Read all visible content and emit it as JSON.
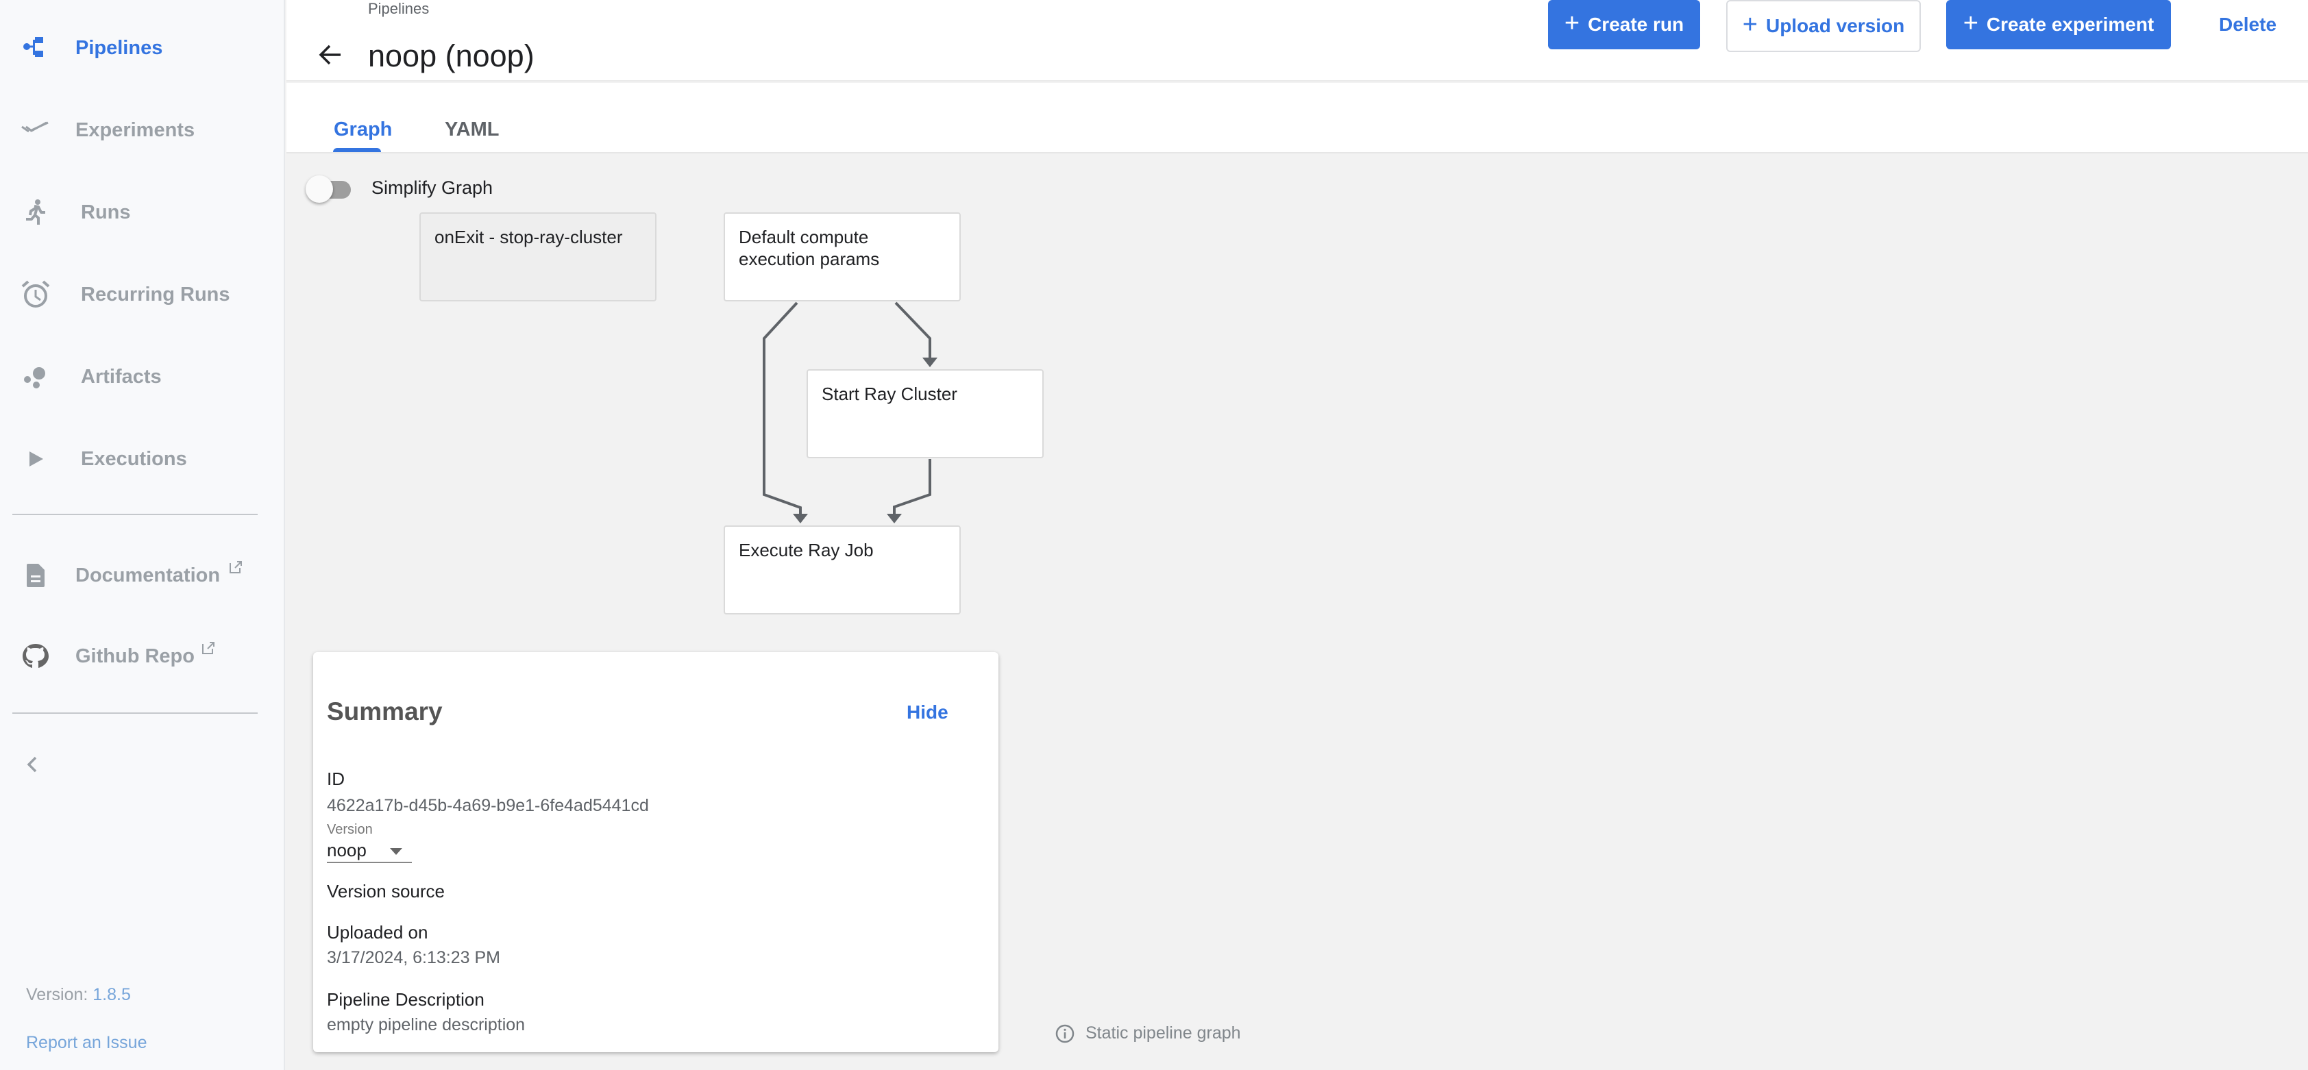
{
  "sidebar": {
    "items": [
      {
        "label": "Pipelines",
        "icon": "pipelines-icon",
        "active": true
      },
      {
        "label": "Experiments",
        "icon": "experiments-icon",
        "active": false
      },
      {
        "label": "Runs",
        "icon": "runs-icon",
        "active": false
      },
      {
        "label": "Recurring Runs",
        "icon": "alarm-clock-icon",
        "active": false
      },
      {
        "label": "Artifacts",
        "icon": "artifacts-icon",
        "active": false
      },
      {
        "label": "Executions",
        "icon": "play-icon",
        "active": false
      }
    ],
    "external_links": [
      {
        "label": "Documentation",
        "icon": "document-icon"
      },
      {
        "label": "Github Repo",
        "icon": "github-icon"
      }
    ],
    "version_prefix": "Version: ",
    "version": "1.8.5",
    "report_issue": "Report an Issue"
  },
  "header": {
    "breadcrumb": "Pipelines",
    "title": "noop (noop)",
    "buttons": {
      "create_run": "Create run",
      "upload_version": "Upload version",
      "create_experiment": "Create experiment",
      "delete": "Delete"
    }
  },
  "tabs": [
    {
      "label": "Graph",
      "active": true
    },
    {
      "label": "YAML",
      "active": false
    }
  ],
  "graph": {
    "simplify_toggle_label": "Simplify Graph",
    "simplify_enabled": false,
    "nodes": [
      {
        "id": "exit",
        "label": "onExit - stop-ray-cluster"
      },
      {
        "id": "default",
        "label": "Default compute execution params"
      },
      {
        "id": "start",
        "label": "Start Ray Cluster"
      },
      {
        "id": "execute",
        "label": "Execute Ray Job"
      }
    ],
    "edges": [
      {
        "from": "default",
        "to": "start"
      },
      {
        "from": "default",
        "to": "execute"
      },
      {
        "from": "start",
        "to": "execute"
      }
    ],
    "static_note": "Static pipeline graph"
  },
  "summary": {
    "title": "Summary",
    "hide_label": "Hide",
    "id_label": "ID",
    "id_value": "4622a17b-d45b-4a69-b9e1-6fe4ad5441cd",
    "version_label": "Version",
    "version_value": "noop",
    "version_source_label": "Version source",
    "uploaded_label": "Uploaded on",
    "uploaded_value": "3/17/2024, 6:13:23 PM",
    "description_label": "Pipeline Description",
    "description_value": "empty pipeline description"
  },
  "colors": {
    "accent": "#3474e0",
    "sidebar_bg": "#f8f9fb",
    "canvas_bg": "#f2f2f2",
    "edge": "#5f6368"
  }
}
